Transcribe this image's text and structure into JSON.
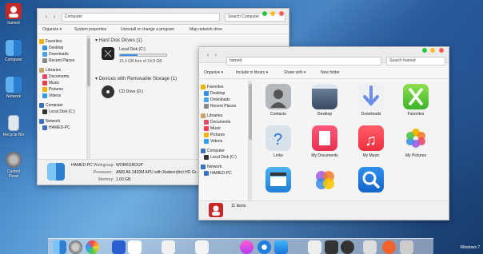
{
  "desktop": {
    "icons": [
      {
        "label": "hamed",
        "icon": "user-icon"
      },
      {
        "label": "Computer",
        "icon": "finder-icon"
      },
      {
        "label": "Network",
        "icon": "network-icon"
      },
      {
        "label": "Recycle Bin",
        "icon": "trash-icon"
      },
      {
        "label": "Control Panel",
        "icon": "settings-icon"
      }
    ],
    "os_label": "Windows 7"
  },
  "computer_window": {
    "address": "Computer",
    "search_placeholder": "Search Computer",
    "toolbar": [
      "Organize ▾",
      "System properties",
      "Uninstall or change a program",
      "Map network drive"
    ],
    "sidebar": {
      "favorites_header": "Favorites",
      "favorites": [
        "Desktop",
        "Downloads",
        "Recent Places"
      ],
      "libraries_header": "Libraries",
      "libraries": [
        "Documents",
        "Music",
        "Pictures",
        "Videos"
      ],
      "computer_header": "Computer",
      "computer_items": [
        "Local Disk (C:)"
      ],
      "network_header": "Network",
      "network_items": [
        "HAMED-PC"
      ]
    },
    "hdd_section": "Hard Disk Drives (1)",
    "disk_name": "Local Disk (C:)",
    "disk_free": "15.4 GB free of 24.8 GB",
    "disk_used_fraction": 0.38,
    "removable_section": "Devices with Removable Storage (1)",
    "cd_name": "CD Drive (D:)",
    "details": {
      "pc_name": "HAMED-PC",
      "workgroup_label": "Workgroup:",
      "workgroup_value": "WORKGROUP",
      "processor_label": "Processor:",
      "processor_value": "AMD A6-3420M APU with Radeon(tm) HD Gr...",
      "memory_label": "Memory:",
      "memory_value": "1.00 GB"
    }
  },
  "user_window": {
    "address": "hamed",
    "search_placeholder": "Search hamed",
    "toolbar": [
      "Organize ▾",
      "Include in library ▾",
      "Share with ▾",
      "New folder"
    ],
    "sidebar": {
      "favorites_header": "Favorites",
      "favorites": [
        "Desktop",
        "Downloads",
        "Recent Places"
      ],
      "libraries_header": "Libraries",
      "libraries": [
        "Documents",
        "Music",
        "Pictures",
        "Videos"
      ],
      "computer_header": "Computer",
      "computer_items": [
        "Local Disk (C:)"
      ],
      "network_header": "Network",
      "network_items": [
        "HAMED-PC"
      ]
    },
    "items": [
      {
        "label": "Contacts",
        "icon": "contacts-icon"
      },
      {
        "label": "Desktop",
        "icon": "desktop-icon"
      },
      {
        "label": "Downloads",
        "icon": "downloads-icon"
      },
      {
        "label": "Favorites",
        "icon": "favorites-icon"
      },
      {
        "label": "Links",
        "icon": "links-icon"
      },
      {
        "label": "My Documents",
        "icon": "documents-icon"
      },
      {
        "label": "My Music",
        "icon": "music-icon"
      },
      {
        "label": "My Pictures",
        "icon": "pictures-icon"
      },
      {
        "label": "",
        "icon": "videos-icon"
      },
      {
        "label": "",
        "icon": "game-center-icon"
      },
      {
        "label": "",
        "icon": "searches-icon"
      }
    ],
    "status": "11 items"
  },
  "dock": {
    "apps": [
      "finder-icon",
      "system-prefs-icon",
      "color-wheel-icon",
      "xcode-icon",
      "pen-icon",
      "ical-icon",
      "itunes-icon",
      "photos-icon",
      "safari-icon",
      "app-store-icon",
      "mail-icon",
      "calculator-icon",
      "dashboard-icon",
      "photo-booth-icon",
      "sleep-icon",
      "trash-icon"
    ]
  },
  "colors": {
    "accent": "#3a8ee6",
    "close": "#fc5f57",
    "minimize": "#fdbc2e",
    "maximize": "#29c840"
  }
}
